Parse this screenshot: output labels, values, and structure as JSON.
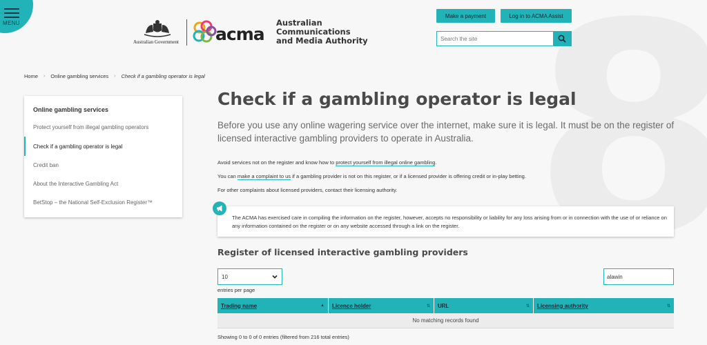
{
  "menu": {
    "label": "MENU"
  },
  "watermark": "8",
  "header": {
    "gov_label": "Australian Government",
    "acma_word": "acma",
    "acma_full_lines": [
      "Australian",
      "Communications",
      "and Media Authority"
    ],
    "make_payment": "Make a payment",
    "login": "Log in to ACMA Assist",
    "search_placeholder": "Search the site"
  },
  "breadcrumb": {
    "home": "Home",
    "section": "Online gambling services",
    "current": "Check if a gambling operator is legal"
  },
  "sidebar": {
    "title": "Online gambling services",
    "items": [
      {
        "label": "Protect yourself from illegal gambling operators"
      },
      {
        "label": "Check if a gambling operator is legal"
      },
      {
        "label": "Credit ban"
      },
      {
        "label": "About the Interactive Gambling Act"
      },
      {
        "label": "BetStop – the National Self-Exclusion Register™"
      }
    ]
  },
  "main": {
    "title": "Check if a gambling operator is legal",
    "intro": "Before you use any online wagering service over the internet, make sure it is legal. It must be on the register of licensed interactive gambling providers to operate in Australia.",
    "p1_pre": "Avoid services not on the register and know how to ",
    "p1_link": "protect yourself from illegal online gambling",
    "p1_post": ".",
    "p2_pre": "You can ",
    "p2_link": "make a complaint to us",
    "p2_post": " if a gambling provider is not on this register, or if a licensed provider is offering credit or in-play betting.",
    "p3": "For other complaints about licensed providers, contact their licensing authority.",
    "notice": "The ACMA has exercised care in compiling the information on the register, however, accepts no responsibility or liability for any loss arising from or in connection with the use of or reliance on any information contained on the register or on any website accessed through a link on the register."
  },
  "register": {
    "title": "Register of licensed interactive gambling providers",
    "per_page_value": "10",
    "per_page_label": "entries per page",
    "filter_value": "alawin",
    "columns": [
      "Trading name",
      "Licence holder",
      "URL",
      "Licensing authority"
    ],
    "empty_message": "No matching records found",
    "showing": "Showing 0 to 0 of 0 entries (filtered from 216 total entries)"
  },
  "colors": {
    "accent": "#21b3b8",
    "dark": "#0d2b33"
  }
}
